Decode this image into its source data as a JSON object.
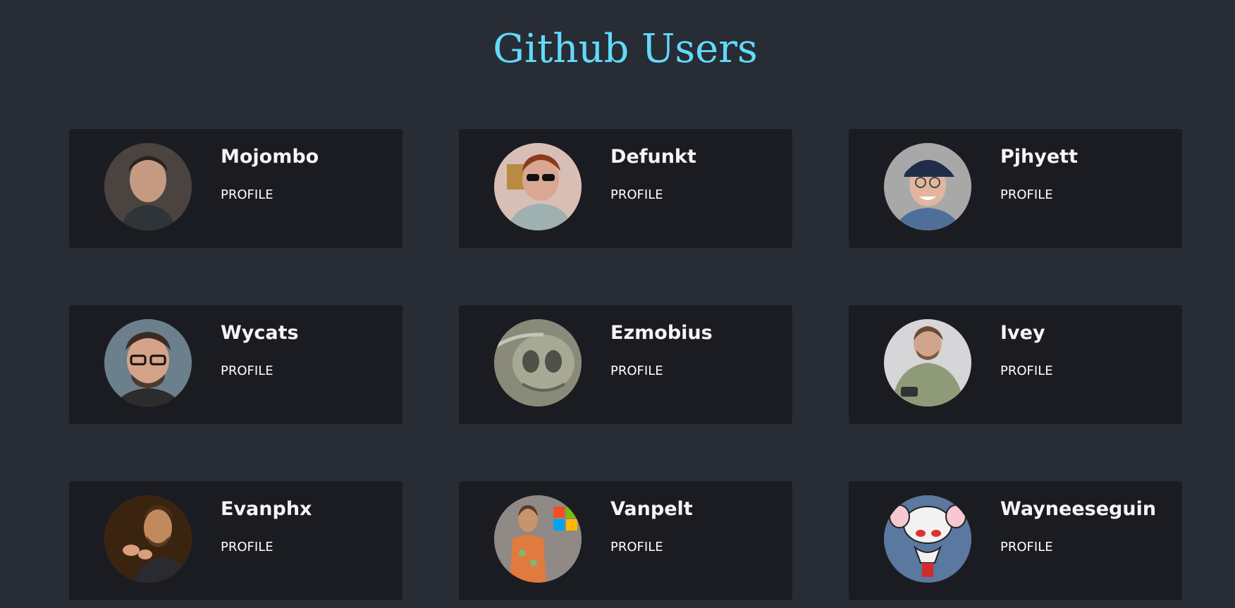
{
  "page": {
    "title": "Github Users",
    "accent_color": "#61dafb",
    "background": "#282c34",
    "card_background": "#1b1c21"
  },
  "users": [
    {
      "name": "Mojombo",
      "link_label": "PROFILE",
      "avatar": "photo of man with dark hair"
    },
    {
      "name": "Defunkt",
      "link_label": "PROFILE",
      "avatar": "photo of man with sunglasses"
    },
    {
      "name": "Pjhyett",
      "link_label": "PROFILE",
      "avatar": "photo of man with cap and glasses"
    },
    {
      "name": "Wycats",
      "link_label": "PROFILE",
      "avatar": "photo of man with glasses and beard"
    },
    {
      "name": "Ezmobius",
      "link_label": "PROFILE",
      "avatar": "alien illustration"
    },
    {
      "name": "Ivey",
      "link_label": "PROFILE",
      "avatar": "photo of man in green sweater"
    },
    {
      "name": "Evanphx",
      "link_label": "PROFILE",
      "avatar": "photo of man gesturing"
    },
    {
      "name": "Vanpelt",
      "link_label": "PROFILE",
      "avatar": "photo of man on stage with windows logo"
    },
    {
      "name": "Wayneeseguin",
      "link_label": "PROFILE",
      "avatar": "cartoon of brain mouse character"
    }
  ]
}
